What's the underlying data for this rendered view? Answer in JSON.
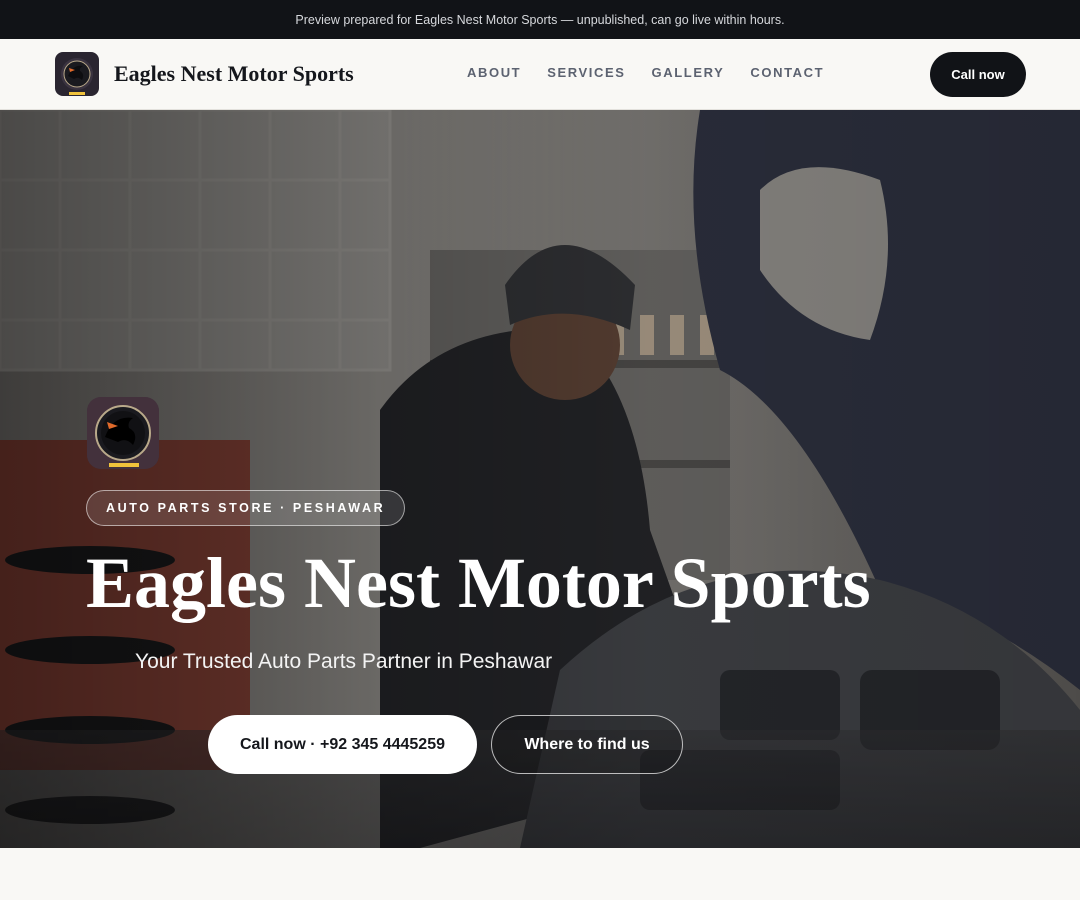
{
  "preview_banner": "Preview prepared for Eagles Nest Motor Sports — unpublished, can go live within hours.",
  "header": {
    "brand": "Eagles Nest Motor Sports",
    "logo_icon": "eagle-logo-icon",
    "nav": [
      "ABOUT",
      "SERVICES",
      "GALLERY",
      "CONTACT"
    ],
    "call_label": "Call now"
  },
  "hero": {
    "eyebrow": "AUTO PARTS STORE · PESHAWAR",
    "title": "Eagles Nest Motor Sports",
    "subtitle": "Your Trusted Auto Parts Partner in Peshawar",
    "primary_cta": "Call now · +92 345 4445259",
    "secondary_cta": "Where to find us",
    "background_image": "mechanic working under car hood in garage"
  },
  "colors": {
    "dark": "#111317",
    "light_bg": "#f9f8f5",
    "nav_text": "#5c6270"
  }
}
